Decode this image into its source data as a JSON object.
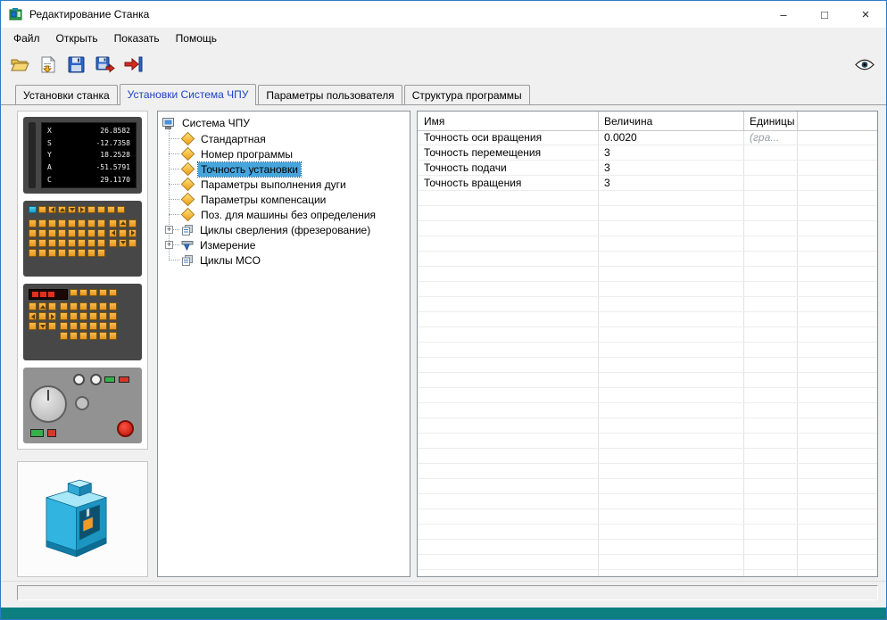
{
  "window": {
    "title": "Редактирование Станка",
    "controls": {
      "minimize": "–",
      "maximize": "□",
      "close": "×"
    }
  },
  "menu": {
    "items": [
      {
        "label": "Файл"
      },
      {
        "label": "Открыть"
      },
      {
        "label": "Показать"
      },
      {
        "label": "Помощь"
      }
    ]
  },
  "toolbar": {
    "icons": [
      "open-file-icon",
      "import-icon",
      "save-icon",
      "save-as-icon",
      "export-icon",
      "eye-icon"
    ]
  },
  "tabs": [
    {
      "label": "Установки станка",
      "active": false
    },
    {
      "label": "Установки Система ЧПУ",
      "active": true
    },
    {
      "label": "Параметры пользователя",
      "active": false
    },
    {
      "label": "Структура программы",
      "active": false
    }
  ],
  "left_panel": {
    "dro": {
      "rows": [
        {
          "axis": "X",
          "value": "26.8582"
        },
        {
          "axis": "S",
          "value": "-12.7358"
        },
        {
          "axis": "Y",
          "value": "18.2528"
        },
        {
          "axis": "A",
          "value": "-51.5791"
        },
        {
          "axis": "C",
          "value": "29.1170"
        }
      ]
    }
  },
  "tree": {
    "root_label": "Система ЧПУ",
    "expander_glyph": "+",
    "items": [
      {
        "label": "Стандартная",
        "icon": "diamond-icon",
        "selected": false
      },
      {
        "label": "Номер программы",
        "icon": "diamond-icon",
        "selected": false
      },
      {
        "label": "Точность установки",
        "icon": "diamond-icon",
        "selected": true
      },
      {
        "label": "Параметры выполнения дуги",
        "icon": "diamond-icon",
        "selected": false
      },
      {
        "label": "Параметры компенсации",
        "icon": "diamond-icon",
        "selected": false
      },
      {
        "label": "Поз. для машины без определения",
        "icon": "diamond-icon",
        "selected": false
      },
      {
        "label": "Циклы сверления (фрезерование)",
        "icon": "cycles-icon",
        "expandable": true,
        "selected": false
      },
      {
        "label": "Измерение",
        "icon": "measure-icon",
        "expandable": true,
        "selected": false
      },
      {
        "label": "Циклы MCO",
        "icon": "cycles-icon",
        "selected": false
      }
    ]
  },
  "table": {
    "columns": [
      {
        "label": "Имя"
      },
      {
        "label": "Величина"
      },
      {
        "label": "Единицы"
      }
    ],
    "rows": [
      {
        "name": "Точность оси вращения",
        "value": "0.0020",
        "units": "(гра..."
      },
      {
        "name": "Точность перемещения",
        "value": "3",
        "units": ""
      },
      {
        "name": "Точность подачи",
        "value": "3",
        "units": ""
      },
      {
        "name": "Точность вращения",
        "value": "3",
        "units": ""
      }
    ]
  },
  "colors": {
    "active_tab_text": "#1f42c8",
    "tree_selection_bg": "#46a5dd",
    "bottom_strip": "#0e7f80",
    "key_orange": "#f2a93b",
    "machine_cyan": "#2eb3dd"
  }
}
